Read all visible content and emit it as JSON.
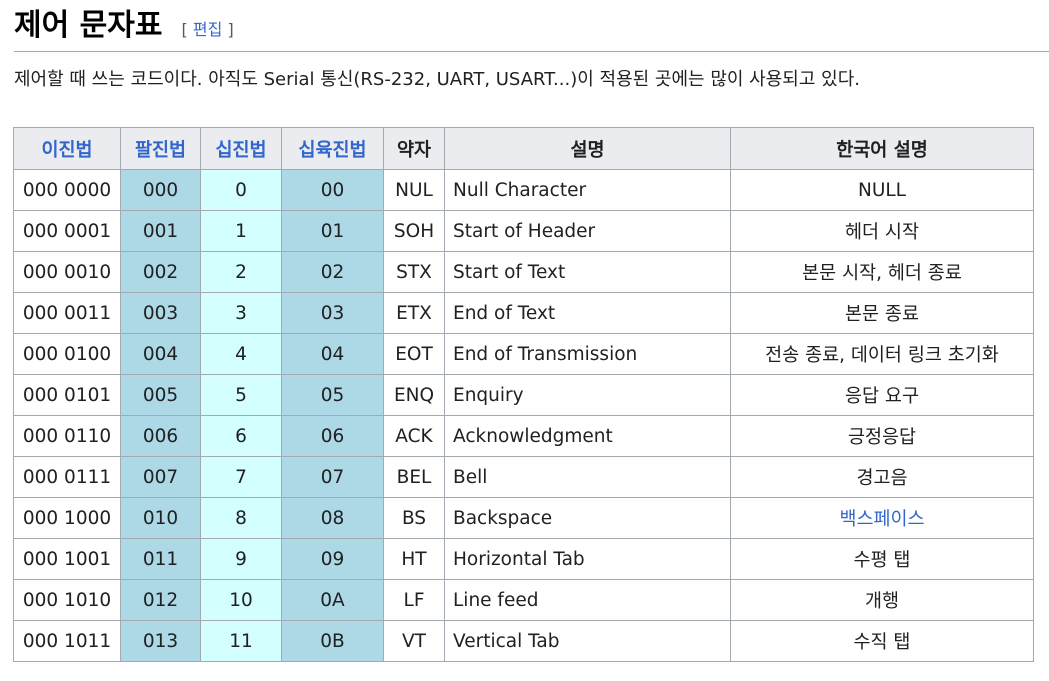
{
  "section": {
    "title": "제어 문자표",
    "edit_open": "[",
    "edit_label": "편집",
    "edit_close": "]"
  },
  "intro": "제어할 때 쓰는 코드이다. 아직도 Serial 통신(RS-232, UART, USART...)이 적용된 곳에는 많이 사용되고 있다.",
  "table": {
    "headers": [
      "이진법",
      "팔진법",
      "십진법",
      "십육진법",
      "약자",
      "설명",
      "한국어 설명"
    ],
    "rows": [
      {
        "bin": "000 0000",
        "oct": "000",
        "dec": "0",
        "hex": "00",
        "abbr": "NUL",
        "desc": "Null Character",
        "ko": "NULL"
      },
      {
        "bin": "000 0001",
        "oct": "001",
        "dec": "1",
        "hex": "01",
        "abbr": "SOH",
        "desc": "Start of Header",
        "ko": "헤더 시작"
      },
      {
        "bin": "000 0010",
        "oct": "002",
        "dec": "2",
        "hex": "02",
        "abbr": "STX",
        "desc": "Start of Text",
        "ko": "본문 시작, 헤더 종료"
      },
      {
        "bin": "000 0011",
        "oct": "003",
        "dec": "3",
        "hex": "03",
        "abbr": "ETX",
        "desc": "End of Text",
        "ko": "본문 종료"
      },
      {
        "bin": "000 0100",
        "oct": "004",
        "dec": "4",
        "hex": "04",
        "abbr": "EOT",
        "desc": "End of Transmission",
        "ko": "전송 종료, 데이터 링크 초기화"
      },
      {
        "bin": "000 0101",
        "oct": "005",
        "dec": "5",
        "hex": "05",
        "abbr": "ENQ",
        "desc": "Enquiry",
        "ko": "응답 요구"
      },
      {
        "bin": "000 0110",
        "oct": "006",
        "dec": "6",
        "hex": "06",
        "abbr": "ACK",
        "desc": "Acknowledgment",
        "ko": "긍정응답"
      },
      {
        "bin": "000 0111",
        "oct": "007",
        "dec": "7",
        "hex": "07",
        "abbr": "BEL",
        "desc": "Bell",
        "ko": "경고음"
      },
      {
        "bin": "000 1000",
        "oct": "010",
        "dec": "8",
        "hex": "08",
        "abbr": "BS",
        "desc": "Backspace",
        "ko": "백스페이스",
        "ko_link": true
      },
      {
        "bin": "000 1001",
        "oct": "011",
        "dec": "9",
        "hex": "09",
        "abbr": "HT",
        "desc": "Horizontal Tab",
        "ko": "수평 탭"
      },
      {
        "bin": "000 1010",
        "oct": "012",
        "dec": "10",
        "hex": "0A",
        "abbr": "LF",
        "desc": "Line feed",
        "ko": "개행"
      },
      {
        "bin": "000 1011",
        "oct": "013",
        "dec": "11",
        "hex": "0B",
        "abbr": "VT",
        "desc": "Vertical Tab",
        "ko": "수직 탭"
      }
    ]
  },
  "colors": {
    "link": "#3366cc",
    "octal_hex_bg": "#add8e6",
    "decimal_bg": "#d4ffff",
    "header_bg": "#eaecf0"
  }
}
